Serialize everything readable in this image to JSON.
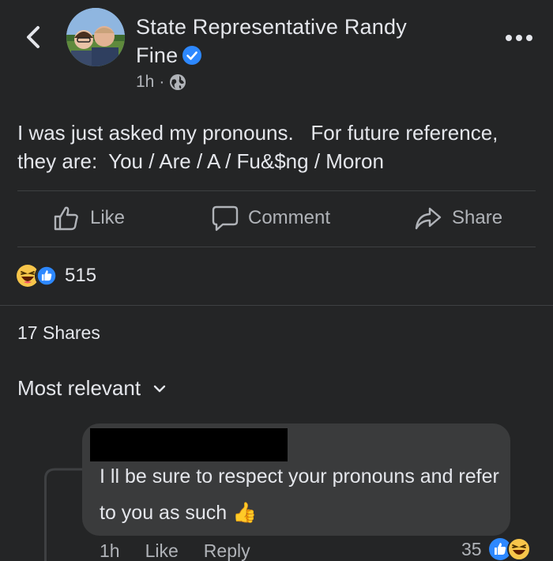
{
  "post": {
    "author_line1": "State Representative Randy",
    "author_line2": "Fine",
    "time": "1h",
    "dot": "·",
    "body": "I was just asked my pronouns.   For future reference,\nthey are:  You / Are / A / Fu&$ng / Moron"
  },
  "actions": {
    "like_label": "Like",
    "comment_label": "Comment",
    "share_label": "Share"
  },
  "reactions": {
    "count": "515",
    "icons": [
      "haha-icon",
      "like-icon"
    ]
  },
  "shares": {
    "label": "17 Shares"
  },
  "sort": {
    "label": "Most relevant"
  },
  "comment": {
    "text": "I ll be sure to respect your pronouns and refer to you as such 👍",
    "time": "1h",
    "like_label": "Like",
    "reply_label": "Reply",
    "reaction_count": "35"
  },
  "colors": {
    "background": "#242526",
    "bubble": "#3a3b3c",
    "accent_blue": "#2d88ff",
    "haha_yellow": "#f7c54a",
    "secondary_text": "#b0b3b8"
  }
}
